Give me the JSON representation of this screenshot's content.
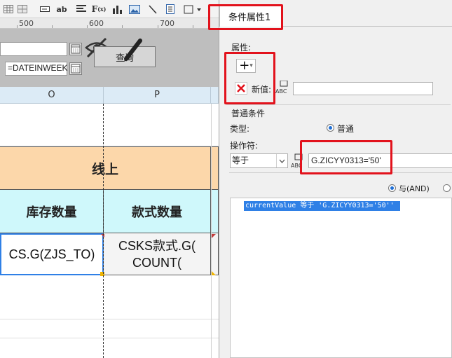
{
  "ruler": {
    "marks": [
      "500",
      "600",
      "700"
    ]
  },
  "params": {
    "date_field": "=DATEINWEEK",
    "query_button": "查询"
  },
  "columns": [
    "O",
    "P"
  ],
  "sheet": {
    "merged_header": "线上",
    "headers": [
      "库存数量",
      "款式数量"
    ],
    "formula_o": "CS.G(ZJS_TO)",
    "formula_p_line1": "CSKS款式.G(",
    "formula_p_line2": "COUNT("
  },
  "panel": {
    "tab_title": "条件属性1",
    "section_attr": "属性:",
    "add_button": "+",
    "add_dropdown": "▾",
    "new_value_label": "新值:",
    "new_value_input": "",
    "section_general": "普通条件",
    "type_label": "类型:",
    "type_value": "普通",
    "operator_label": "操作符:",
    "operator_value": "等于",
    "condition_value": "G.ZICYY0313='50'",
    "and_label": "与(AND)",
    "condition_list": [
      "currentValue 等于 'G.ZICYY0313='50'' "
    ]
  },
  "colors": {
    "highlight_red": "#e2121c",
    "selection_blue": "#2f80e6",
    "orange_cell": "#fcd7aa",
    "cyan_cell": "#cff8fb"
  }
}
